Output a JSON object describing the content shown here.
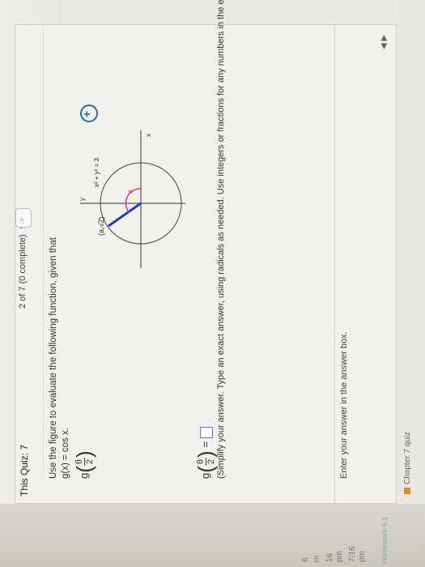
{
  "header": {
    "quiz_title": "This Quiz: 7",
    "progress": "2 of 7 (0 complete)",
    "progress_chevron": "▾"
  },
  "question": {
    "intro": "Use the figure to evaluate the following function, given that",
    "given": "g(x) = cos x.",
    "expr_func": "g",
    "expr_num": "θ",
    "expr_den": "2"
  },
  "figure": {
    "point_label": "(a,√2)",
    "circle_eq": "x² + y² = 3",
    "axis_y": "y",
    "axis_x": "x",
    "angle_label": "θ",
    "accent_color": "#d23b8e",
    "line_color": "#1f3fbf"
  },
  "answer": {
    "lhs_func": "g",
    "lhs_num": "θ",
    "lhs_den": "2",
    "equals": "=",
    "instructions": "(Simplify your answer. Type an exact answer, using radicals as needed. Use integers or fractions for any numbers in the expression.)"
  },
  "footer": {
    "message": "Enter your answer in the answer box.",
    "nav_arrows": "◀ ▶"
  },
  "sidebar": {
    "items": [
      "7/16",
      "pm",
      "16",
      "pm",
      "m",
      "6"
    ]
  },
  "bottom": {
    "chapter": "Chapter 7 quiz",
    "dates": [
      "7/16",
      "5pm"
    ],
    "homework": "Homework 6.1"
  }
}
